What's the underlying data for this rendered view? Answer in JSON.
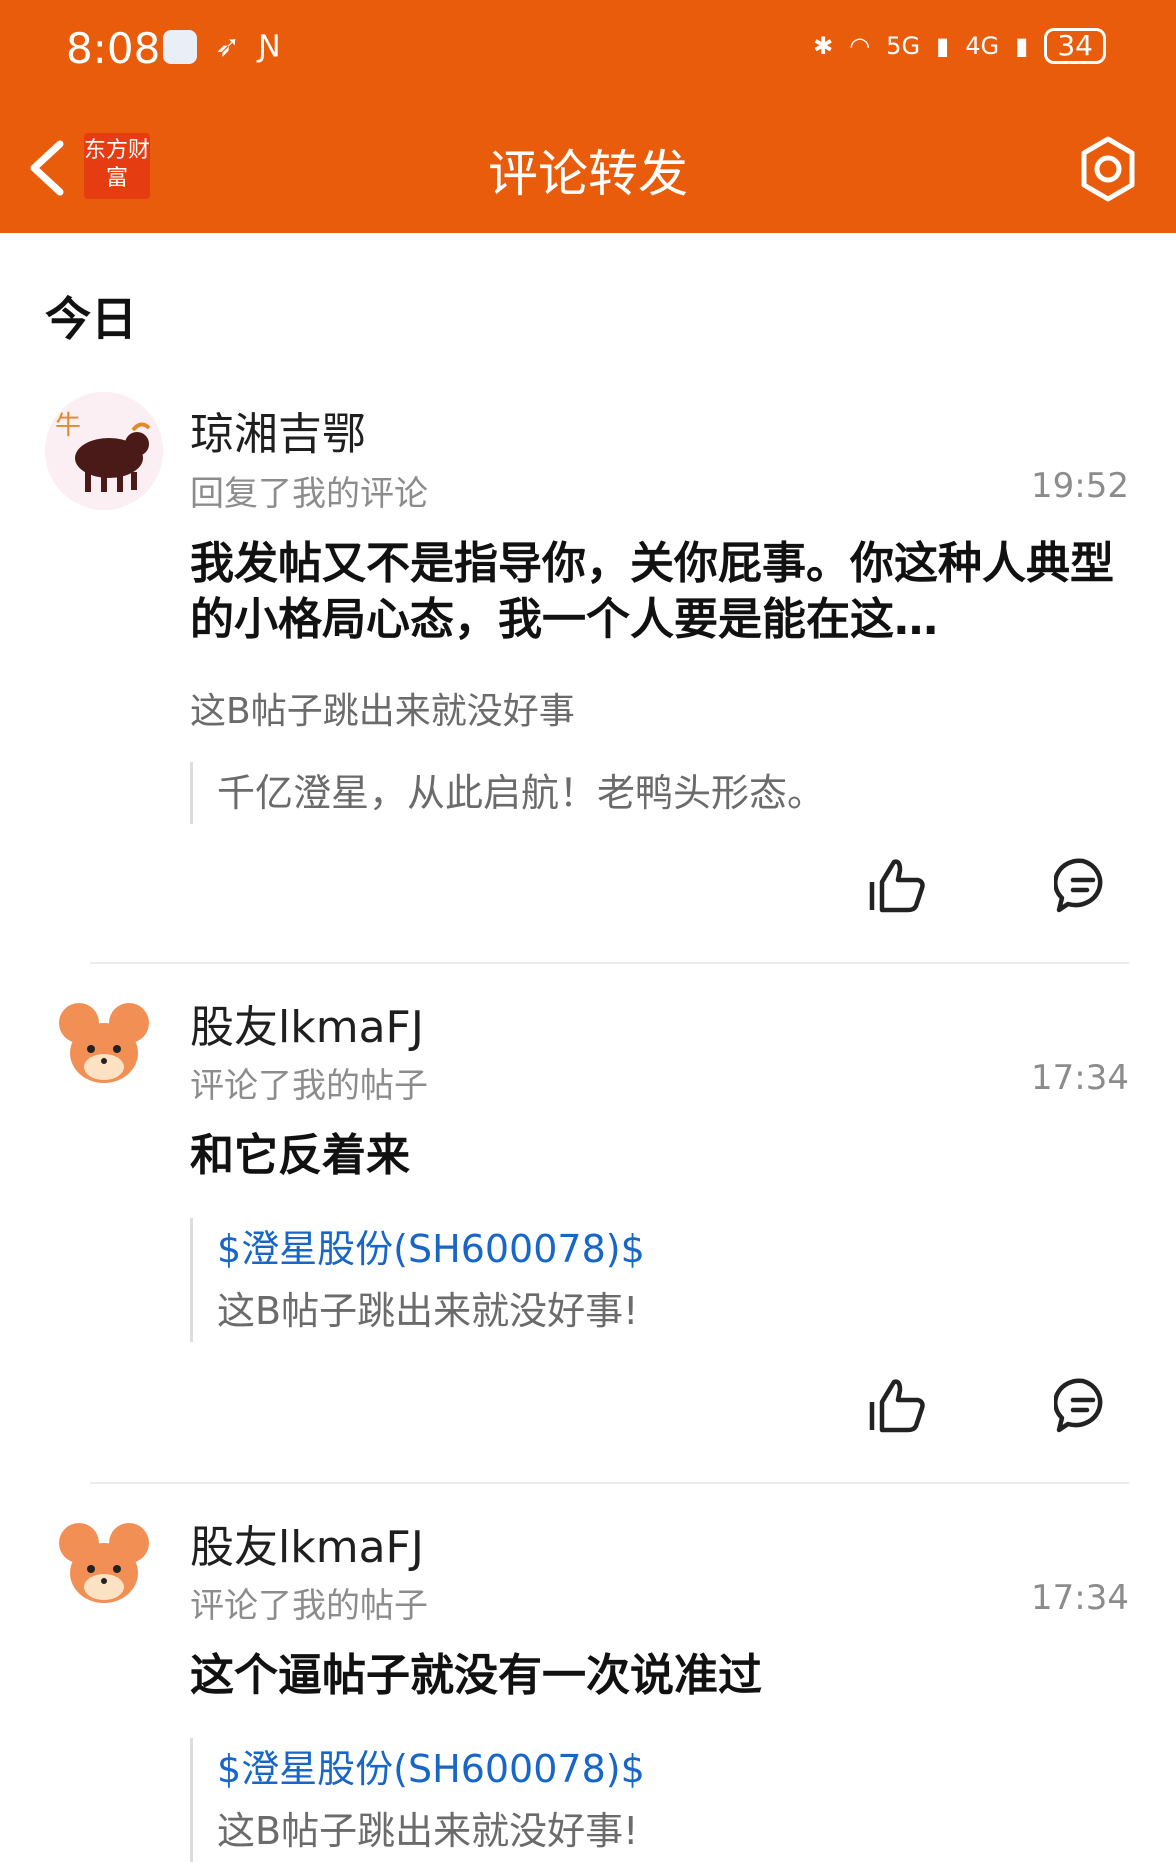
{
  "status_bar": {
    "time": "8:08",
    "network_5g": "5G",
    "network_4g": "4G",
    "battery": "34"
  },
  "header": {
    "logo_text": "东方财富",
    "title": "评论转发"
  },
  "section": {
    "title": "今日"
  },
  "items": [
    {
      "username": "琼湘吉鄂",
      "action": "回复了我的评论",
      "time": "19:52",
      "comment": "我发帖又不是指导你，关你屁事。你这种人典型的小格局心态，我一个人要是能在这…",
      "reply": "这B帖子跳出来就没好事",
      "quote": "千亿澄星，从此启航！老鸭头形态。"
    },
    {
      "username": "股友lkmaFJ",
      "action": "评论了我的帖子",
      "time": "17:34",
      "comment": "和它反着来",
      "quote_stock": "$澄星股份(SH600078)$",
      "quote_text": "这B帖子跳出来就没好事!"
    },
    {
      "username": "股友lkmaFJ",
      "action": "评论了我的帖子",
      "time": "17:34",
      "comment": "这个逼帖子就没有一次说准过",
      "quote_stock": "$澄星股份(SH600078)$",
      "quote_text": "这B帖子跳出来就没好事!"
    }
  ],
  "colors": {
    "brand": "#E95C0B",
    "link": "#1766C8"
  }
}
